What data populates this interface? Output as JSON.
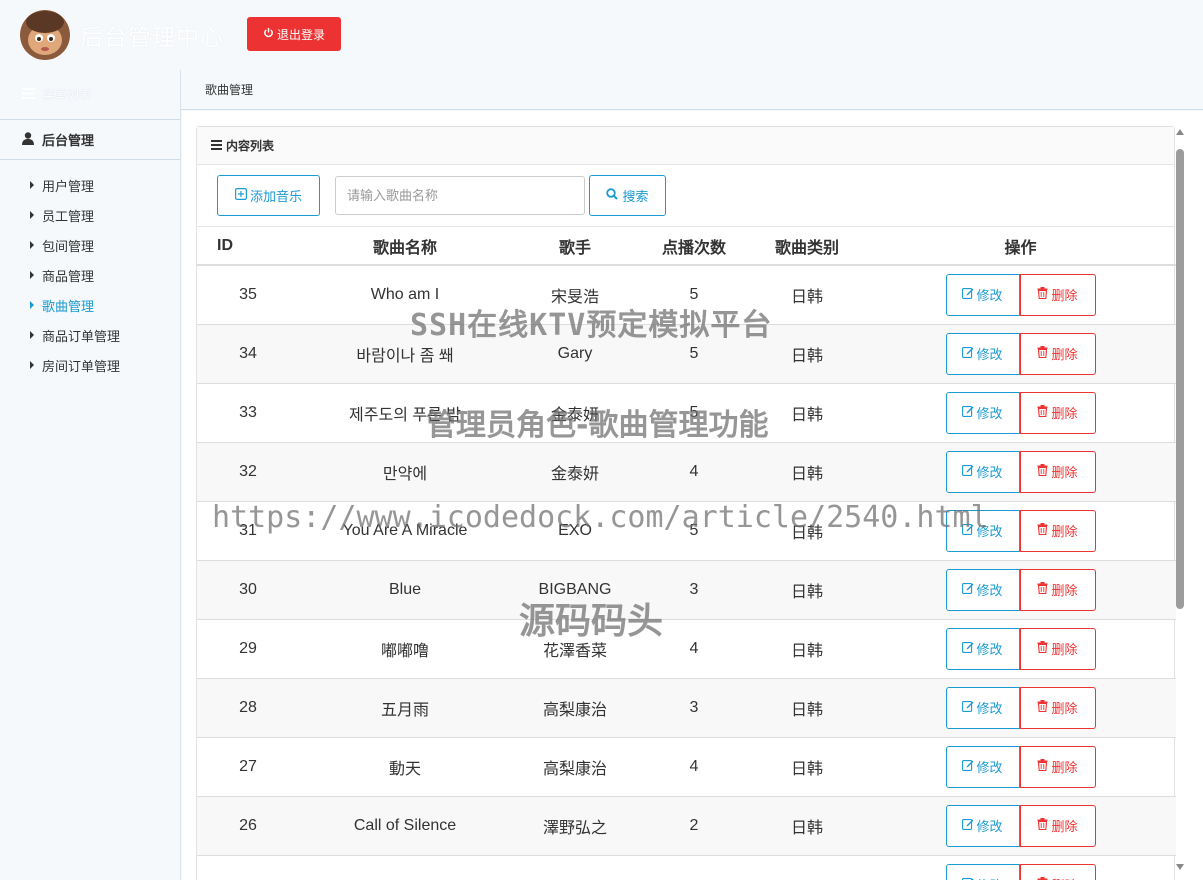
{
  "header": {
    "title": "后台管理中心",
    "logout_label": "退出登录"
  },
  "sidebar": {
    "menu_header": "菜单列表",
    "group_label": "后台管理",
    "items": [
      {
        "label": "用户管理",
        "active": false
      },
      {
        "label": "员工管理",
        "active": false
      },
      {
        "label": "包间管理",
        "active": false
      },
      {
        "label": "商品管理",
        "active": false
      },
      {
        "label": "歌曲管理",
        "active": true
      },
      {
        "label": "商品订单管理",
        "active": false
      },
      {
        "label": "房间订单管理",
        "active": false
      }
    ]
  },
  "breadcrumb": "歌曲管理",
  "panel": {
    "title": "内容列表",
    "add_label": "添加音乐",
    "search_placeholder": "请输入歌曲名称",
    "search_value": "",
    "search_label": "搜索"
  },
  "table": {
    "columns": [
      "ID",
      "歌曲名称",
      "歌手",
      "点播次数",
      "歌曲类别",
      "操作"
    ],
    "edit_label": "修改",
    "delete_label": "删除",
    "rows": [
      {
        "id": "35",
        "name": "Who am I",
        "singer": "宋旻浩",
        "plays": "5",
        "category": "日韩"
      },
      {
        "id": "34",
        "name": "바람이나 좀 쐐",
        "singer": "Gary",
        "plays": "5",
        "category": "日韩"
      },
      {
        "id": "33",
        "name": "제주도의 푸른 밤",
        "singer": "金泰妍",
        "plays": "5",
        "category": "日韩"
      },
      {
        "id": "32",
        "name": "만약에",
        "singer": "金泰妍",
        "plays": "4",
        "category": "日韩"
      },
      {
        "id": "31",
        "name": "You Are A Miracle",
        "singer": "EXO",
        "plays": "5",
        "category": "日韩"
      },
      {
        "id": "30",
        "name": "Blue",
        "singer": "BIGBANG",
        "plays": "3",
        "category": "日韩"
      },
      {
        "id": "29",
        "name": "嘟嘟噜",
        "singer": "花澤香菜",
        "plays": "4",
        "category": "日韩"
      },
      {
        "id": "28",
        "name": "五月雨",
        "singer": "高梨康治",
        "plays": "3",
        "category": "日韩"
      },
      {
        "id": "27",
        "name": "動天",
        "singer": "高梨康治",
        "plays": "4",
        "category": "日韩"
      },
      {
        "id": "26",
        "name": "Call of Silence",
        "singer": "澤野弘之",
        "plays": "2",
        "category": "日韩"
      },
      {
        "id": "",
        "name": "",
        "singer": "",
        "plays": "",
        "category": ""
      }
    ]
  },
  "watermarks": [
    "SSH在线KTV预定模拟平台",
    "管理员角色-歌曲管理功能",
    "https://www.icodedock.com/article/2540.html",
    "源码码头"
  ],
  "colors": {
    "accent": "#1b9bd1",
    "danger": "#e33333",
    "logout_bg": "#ec3232",
    "background": "#f5f9fc"
  }
}
